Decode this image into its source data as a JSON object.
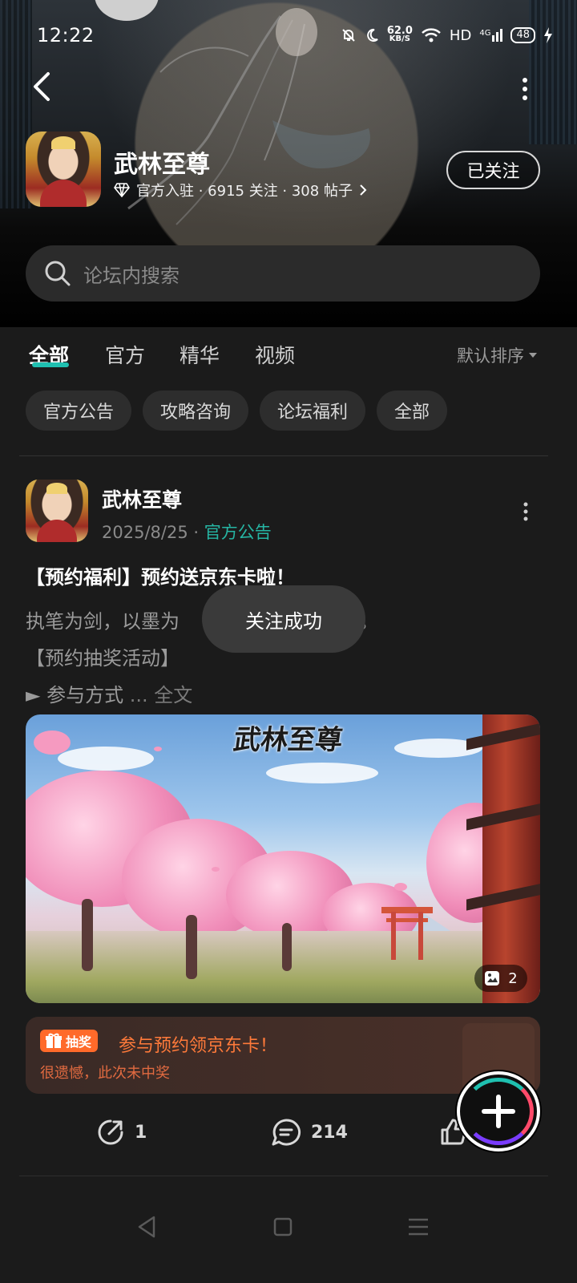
{
  "status_bar": {
    "time": "12:22",
    "network_speed_value": "62.0",
    "network_speed_unit": "KB/S",
    "hd": "HD",
    "signal": "4G",
    "battery": "48"
  },
  "header": {
    "game_name": "武林至尊",
    "meta": "官方入驻 · 6915 关注 · 308 帖子",
    "follow_label": "已关注"
  },
  "search": {
    "placeholder": "论坛内搜索"
  },
  "tabs": [
    {
      "label": "全部",
      "active": true
    },
    {
      "label": "官方",
      "active": false
    },
    {
      "label": "精华",
      "active": false
    },
    {
      "label": "视频",
      "active": false
    }
  ],
  "sort_label": "默认排序",
  "chips": [
    "官方公告",
    "攻略咨询",
    "论坛福利",
    "全部"
  ],
  "post": {
    "author": "武林至尊",
    "date": "2025/8/25",
    "separator": "·",
    "category": "官方公告",
    "title": "【预约福利】预约送京东卡啦！",
    "body_line1": "执笔为剑，以墨为",
    "body_line1_tail": "旅。",
    "body_line2": "【预约抽奖活动】",
    "body_line3": "► 参与方式",
    "more_link": " ... 全文",
    "image_count": "2",
    "banner_logo": "武林至尊",
    "lottery": {
      "tag": "抽奖",
      "title": "参与预约领京东卡！",
      "subtitle": "很遗憾，此次未中奖"
    },
    "shares": "1",
    "comments": "214"
  },
  "toast": "关注成功",
  "colors": {
    "accent": "#1fc0b0",
    "category": "#26b6a4",
    "lottery_orange": "#ff6a2a",
    "background": "#1b1b1b"
  },
  "icons": {
    "back": "back-arrow-icon",
    "more": "more-vertical-icon",
    "verified": "diamond-icon",
    "search": "search-icon",
    "share": "share-icon",
    "comment": "comment-icon",
    "like": "thumbs-up-icon",
    "add": "plus-icon",
    "gallery": "image-icon"
  }
}
